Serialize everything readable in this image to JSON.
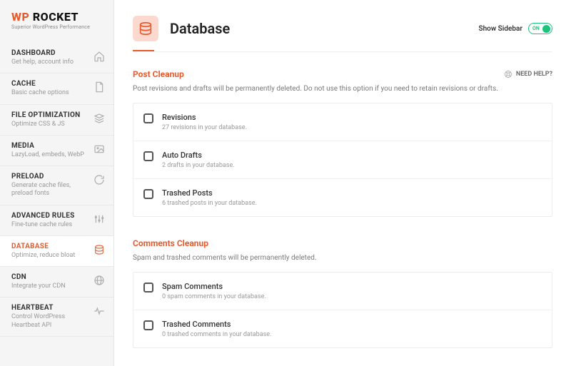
{
  "logo": {
    "wp": "WP",
    "rocket": "ROCKET",
    "tagline": "Superior WordPress Performance"
  },
  "nav": [
    {
      "title": "DASHBOARD",
      "sub": "Get help, account info",
      "icon": "house"
    },
    {
      "title": "CACHE",
      "sub": "Basic cache options",
      "icon": "file"
    },
    {
      "title": "FILE OPTIMIZATION",
      "sub": "Optimize CSS & JS",
      "icon": "stack"
    },
    {
      "title": "MEDIA",
      "sub": "LazyLoad, embeds, WebP",
      "icon": "image"
    },
    {
      "title": "PRELOAD",
      "sub": "Generate cache files, preload fonts",
      "icon": "refresh"
    },
    {
      "title": "ADVANCED RULES",
      "sub": "Fine-tune cache rules",
      "icon": "sliders"
    },
    {
      "title": "DATABASE",
      "sub": "Optimize, reduce bloat",
      "icon": "database",
      "active": true
    },
    {
      "title": "CDN",
      "sub": "Integrate your CDN",
      "icon": "globe"
    },
    {
      "title": "HEARTBEAT",
      "sub": "Control WordPress Heartbeat API",
      "icon": "heartbeat"
    }
  ],
  "header": {
    "title": "Database",
    "show_sidebar": "Show Sidebar",
    "toggle_label": "ON"
  },
  "need_help": "NEED HELP?",
  "sections": [
    {
      "title": "Post Cleanup",
      "desc": "Post revisions and drafts will be permanently deleted. Do not use this option if you need to retain revisions or drafts.",
      "options": [
        {
          "title": "Revisions",
          "sub": "27 revisions in your database."
        },
        {
          "title": "Auto Drafts",
          "sub": "2 drafts in your database."
        },
        {
          "title": "Trashed Posts",
          "sub": "6 trashed posts in your database."
        }
      ]
    },
    {
      "title": "Comments Cleanup",
      "desc": "Spam and trashed comments will be permanently deleted.",
      "options": [
        {
          "title": "Spam Comments",
          "sub": "0 spam comments in your database."
        },
        {
          "title": "Trashed Comments",
          "sub": "0 trashed comments in your database."
        }
      ]
    }
  ]
}
